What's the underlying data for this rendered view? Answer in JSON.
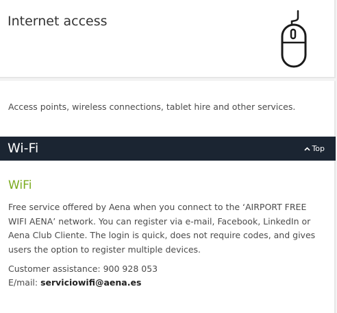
{
  "header": {
    "title": "Internet access",
    "icon": "mouse-icon"
  },
  "intro": "Access points, wireless connections, tablet hire and other services.",
  "section": {
    "title": "Wi-Fi",
    "top_link": "Top",
    "top_icon": "caret-up-icon",
    "bar_color": "#1b2532"
  },
  "wifi": {
    "heading": "WiFi",
    "heading_color": "#7bab1e",
    "description": "Free service offered by Aena when you connect to the ‘AIRPORT FREE WIFI AENA’ network. You can register via e-mail, Facebook, LinkedIn or Aena Club Cliente. The login is quick, does not require codes, and gives users the option to register multiple devices.",
    "assistance": "Customer assistance: 900 928 053",
    "email_label": "E/mail: ",
    "email": "serviciowifi@aena.es"
  }
}
